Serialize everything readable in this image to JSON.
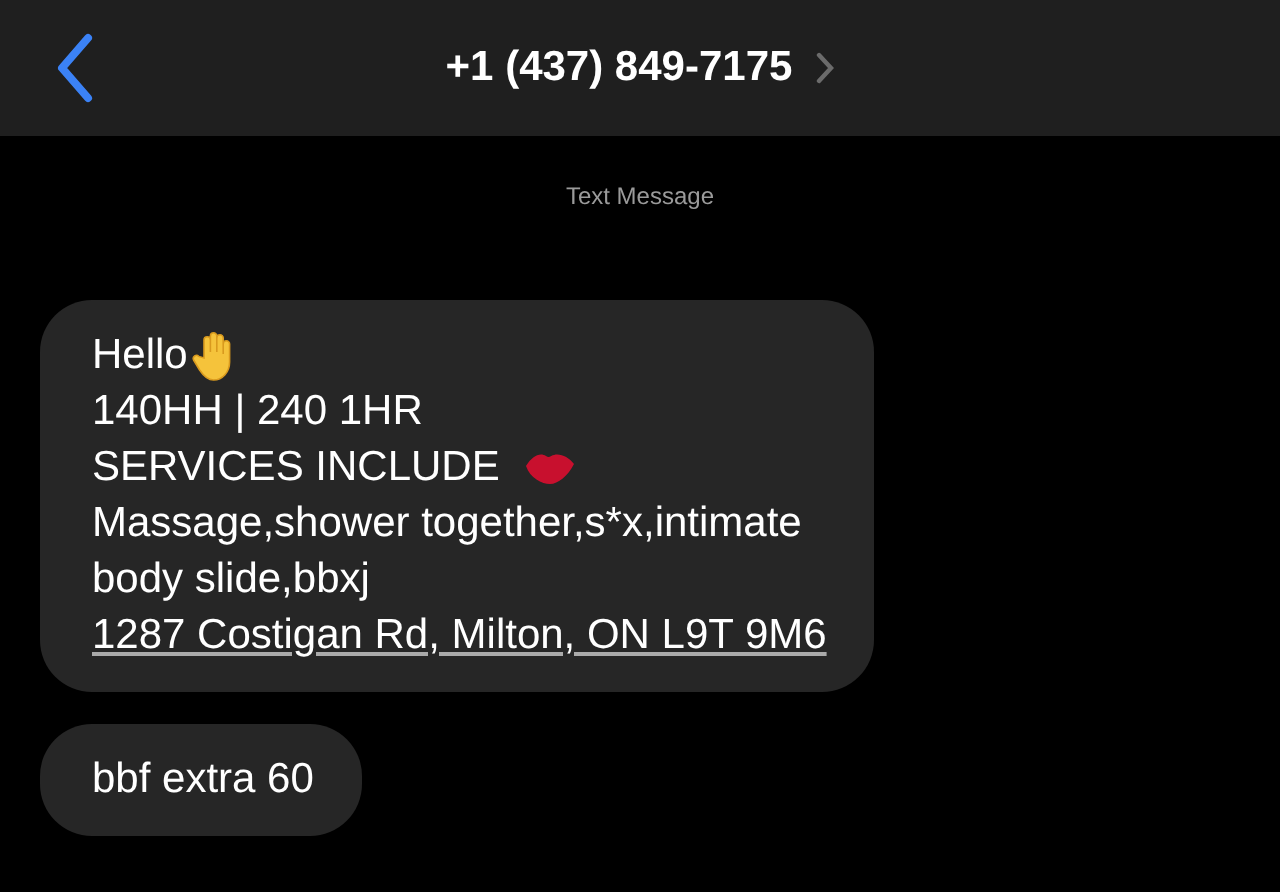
{
  "header": {
    "title": "+1 (437) 849-7175"
  },
  "service_label": "Text Message",
  "messages": [
    {
      "lines": [
        {
          "kind": "greeting",
          "text": "Hello"
        },
        {
          "kind": "plain",
          "text": "140HH | 240 1HR"
        },
        {
          "kind": "heading",
          "text": "SERVICES INCLUDE"
        },
        {
          "kind": "plain",
          "text": "Massage,shower together,s*x,intimate"
        },
        {
          "kind": "plain",
          "text": "body slide,bbxj"
        },
        {
          "kind": "link",
          "text": "1287 Costigan Rd, Milton, ON L9T 9M6"
        }
      ]
    },
    {
      "lines": [
        {
          "kind": "plain",
          "text": "bbf extra 60"
        }
      ]
    }
  ]
}
